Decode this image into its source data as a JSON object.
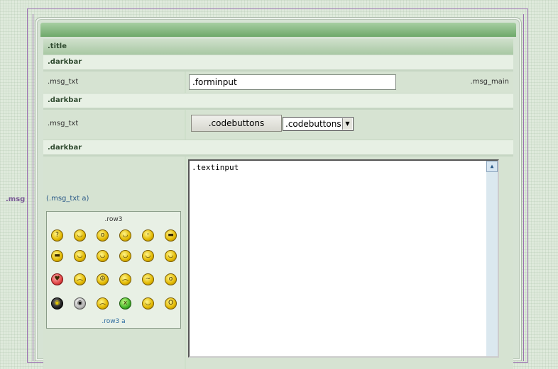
{
  "side_label": ".msg",
  "title_row": {
    "label": ".title"
  },
  "darkbars": [
    ".darkbar",
    ".darkbar",
    ".darkbar"
  ],
  "row1": {
    "left_label": ".msg_txt",
    "input_value": ".forminput",
    "right_label": ".msg_main"
  },
  "row2": {
    "left_label": ".msg_txt",
    "button_label": ".codebuttons",
    "select_value": ".codebuttons"
  },
  "row3": {
    "textinput_value": ".textinput",
    "link_open": "(",
    "link_text": ".msg_txt a",
    "link_close": ")",
    "smiley_box": {
      "title": ".row3",
      "footer_link": ".row3 a"
    }
  },
  "smileys": [
    {
      "name": "smiley-confused-icon",
      "glyph": "?",
      "style": ""
    },
    {
      "name": "smiley-grin-icon",
      "glyph": "◡",
      "style": ""
    },
    {
      "name": "smiley-shocked-icon",
      "glyph": "o",
      "style": ""
    },
    {
      "name": "smiley-smile-icon",
      "glyph": "◡",
      "style": ""
    },
    {
      "name": "smiley-tongue-icon",
      "glyph": "ᵕ",
      "style": ""
    },
    {
      "name": "smiley-laugh-icon",
      "glyph": "▬",
      "style": ""
    },
    {
      "name": "smiley-big-grin-icon",
      "glyph": "▬",
      "style": ""
    },
    {
      "name": "smiley-cool-icon",
      "glyph": "◡",
      "style": ""
    },
    {
      "name": "smiley-eek-icon",
      "glyph": "◡",
      "style": ""
    },
    {
      "name": "smiley-happy-icon",
      "glyph": "◡",
      "style": ""
    },
    {
      "name": "smiley-wink-icon",
      "glyph": "◡",
      "style": ""
    },
    {
      "name": "smiley-neutral-icon",
      "glyph": "◡",
      "style": ""
    },
    {
      "name": "smiley-love-icon",
      "glyph": "♥",
      "style": "red"
    },
    {
      "name": "smiley-angry-icon",
      "glyph": "︵",
      "style": ""
    },
    {
      "name": "smiley-peace-icon",
      "glyph": "☮",
      "style": ""
    },
    {
      "name": "smiley-worried-icon",
      "glyph": "︵",
      "style": ""
    },
    {
      "name": "smiley-rolleyes-icon",
      "glyph": "~",
      "style": ""
    },
    {
      "name": "smiley-dazed-icon",
      "glyph": "o",
      "style": ""
    },
    {
      "name": "smiley-ninja-icon",
      "glyph": "◉",
      "style": "black"
    },
    {
      "name": "smiley-alien-icon",
      "glyph": "◉",
      "style": "grey"
    },
    {
      "name": "smiley-frown-icon",
      "glyph": "︵",
      "style": ""
    },
    {
      "name": "smiley-sick-icon",
      "glyph": "x",
      "style": "green"
    },
    {
      "name": "smiley-sly-icon",
      "glyph": "◡",
      "style": ""
    },
    {
      "name": "smiley-scream-icon",
      "glyph": "O",
      "style": ""
    }
  ]
}
